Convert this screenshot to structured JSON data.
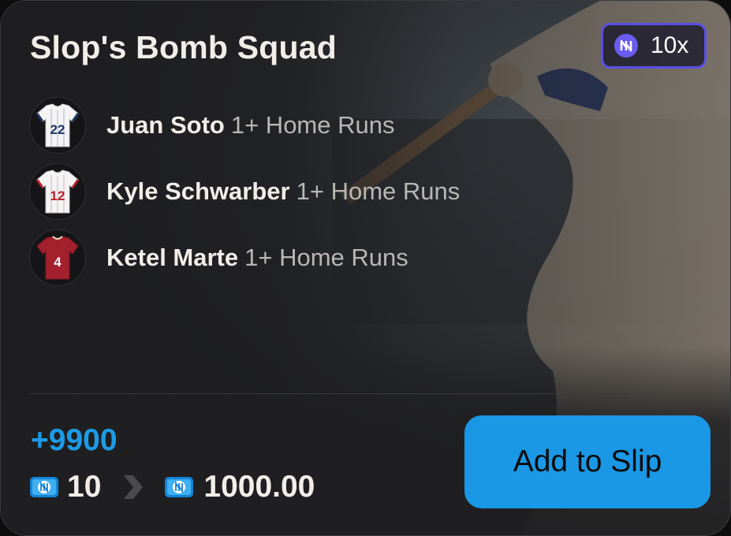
{
  "card": {
    "title": "Slop's Bomb Squad",
    "multiplier": "10x"
  },
  "legs": [
    {
      "player": "Juan Soto",
      "market": "1+ Home Runs",
      "jersey_number": "22",
      "jersey_style": "white-pinstripe-navy"
    },
    {
      "player": "Kyle Schwarber",
      "market": "1+ Home Runs",
      "jersey_number": "12",
      "jersey_style": "white-pinstripe-red"
    },
    {
      "player": "Ketel Marte",
      "market": "1+ Home Runs",
      "jersey_number": "4",
      "jersey_style": "red"
    }
  ],
  "footer": {
    "odds": "+9900",
    "stake": "10",
    "payout": "1000.00",
    "button_label": "Add to Slip"
  },
  "colors": {
    "accent_blue": "#1a98e5",
    "odds_blue": "#1d9be6",
    "multiplier_border": "#5a4fe6",
    "card_bg": "#1f1f21"
  },
  "icons": {
    "multiplier_coin": "n-coin-icon",
    "currency": "ticket-coin-icon",
    "arrow": "chevron-right-icon"
  }
}
